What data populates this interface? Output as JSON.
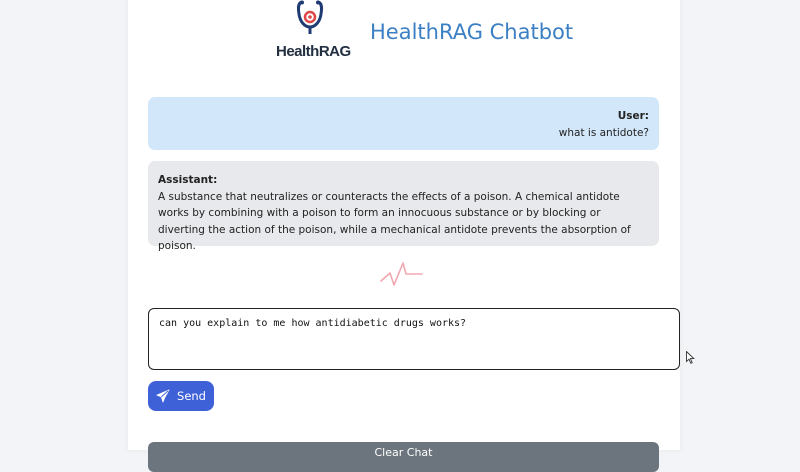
{
  "header": {
    "logo_text": "HealthRAG",
    "title": "HealthRAG Chatbot",
    "brand_color": "#3b7fc4"
  },
  "messages": [
    {
      "role": "User:",
      "text": "what is antidote?"
    },
    {
      "role": "Assistant:",
      "text": "A substance that neutralizes or counteracts the effects of a poison. A chemical antidote works by combining with a poison to form an innocuous substance or by blocking or diverting the action of the poison, while a mechanical antidote prevents the absorption of poison."
    }
  ],
  "input": {
    "value": "can you explain to me how antidiabetic drugs works?"
  },
  "buttons": {
    "send_label": "Send",
    "send_icon": "paper-plane-icon",
    "send_color": "#3f61d8",
    "clear_label": "Clear Chat"
  },
  "indicators": {
    "typing_icon": "heartbeat-icon"
  }
}
